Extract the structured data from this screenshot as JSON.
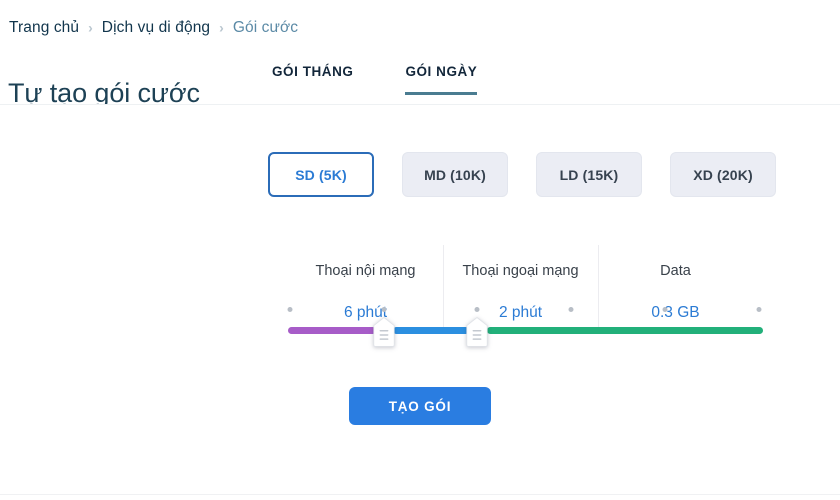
{
  "header": {
    "breadcrumb": {
      "separator": "›",
      "items": [
        {
          "label": "Trang chủ",
          "current": false
        },
        {
          "label": "Dịch vụ di động",
          "current": false
        },
        {
          "label": "Gói cước",
          "current": true
        }
      ]
    },
    "title": "Tự tạo gói cước",
    "tabs": [
      {
        "label": "GÓI THÁNG",
        "active": false
      },
      {
        "label": "GÓI NGÀY",
        "active": true
      }
    ]
  },
  "packages": {
    "options": [
      {
        "label": "SD (5K)",
        "selected": true
      },
      {
        "label": "MD (10K)",
        "selected": false
      },
      {
        "label": "LD (15K)",
        "selected": false
      },
      {
        "label": "XD (20K)",
        "selected": false
      }
    ]
  },
  "stats": [
    {
      "label": "Thoại nội mạng",
      "value": "6 phút"
    },
    {
      "label": "Thoại ngoại mạng",
      "value": "2 phút"
    },
    {
      "label": "Data",
      "value": "0.3 GB"
    }
  ],
  "slider": {
    "tick_positions_pct": [
      0.4,
      20.2,
      39.8,
      59.6,
      79.4,
      99.2
    ],
    "handles_pct": [
      20.2,
      39.8
    ],
    "segments": [
      {
        "name": "thoai-noi-mang",
        "from_pct": 0,
        "to_pct": 18.6,
        "color": "#a75cc8"
      },
      {
        "name": "thoai-ngoai-mang",
        "from_pct": 22.2,
        "to_pct": 38.2,
        "color": "#2b8fe0"
      },
      {
        "name": "data",
        "from_pct": 41.8,
        "to_pct": 100,
        "color": "#22b07a"
      }
    ],
    "track_color": "#e7e9ec",
    "tick_color": "#b8bec6"
  },
  "cta": {
    "label": "TẠO GÓI",
    "color": "#2a7de1"
  },
  "theme": {
    "accent_blue": "#2b7bd4",
    "title_color": "#1d4155",
    "tab_underline": "#4a7c91",
    "breadcrumb_current": "#5b8aa6",
    "pkg_unselected_bg": "#ebedf4"
  }
}
